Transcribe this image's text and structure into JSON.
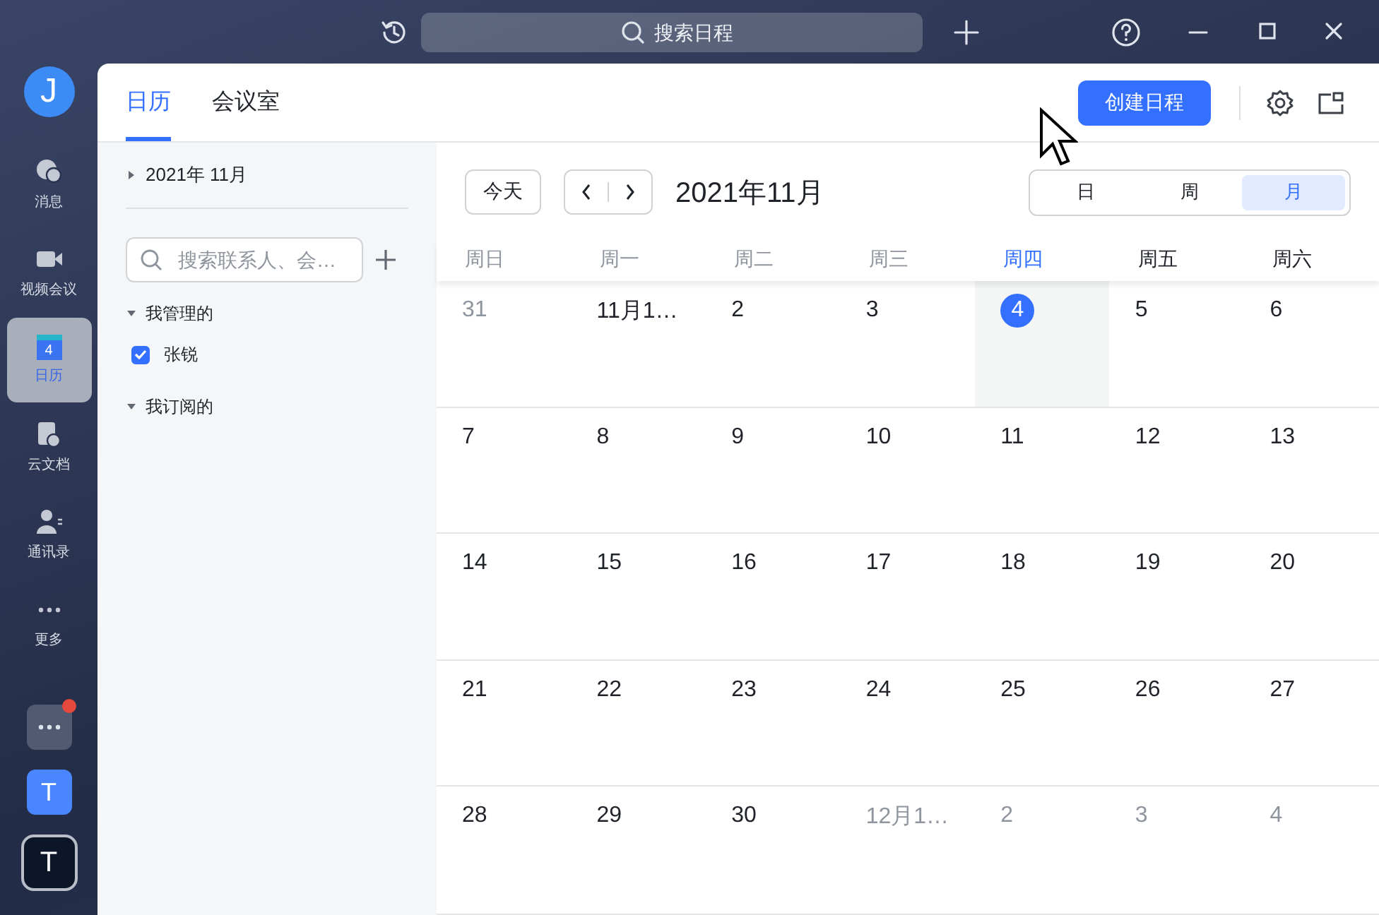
{
  "title_bar": {
    "search": {
      "placeholder": "搜索日程"
    }
  },
  "rail": {
    "avatar": "J",
    "items": [
      {
        "kind": "chat",
        "label": "消息",
        "selected": false
      },
      {
        "kind": "video",
        "label": "视频会议",
        "selected": false
      },
      {
        "kind": "calendar",
        "label": "日历",
        "icon_text": "4",
        "selected": true
      },
      {
        "kind": "docs",
        "label": "云文档",
        "selected": false
      },
      {
        "kind": "contacts",
        "label": "通讯录",
        "selected": false
      },
      {
        "kind": "more",
        "label": "更多",
        "selected": false
      }
    ],
    "apps": [
      {
        "kind": "more",
        "unread": true
      },
      {
        "kind": "app",
        "label": "T",
        "color": "#4a86ff",
        "selected": false
      },
      {
        "kind": "app",
        "label": "T",
        "color": "#0c1628",
        "selected": true
      }
    ]
  },
  "tabs": [
    {
      "label": "日历",
      "selected": true
    },
    {
      "label": "会议室",
      "selected": false
    }
  ],
  "create_button": "创建日程",
  "sidebar": {
    "month_picker": {
      "label": "2021年 11月",
      "expanded": false
    },
    "search": {
      "placeholder": "搜索联系人、会…"
    },
    "groups": [
      {
        "label": "我管理的",
        "expanded": true,
        "children": [
          {
            "label": "张锐",
            "checked": true
          }
        ]
      },
      {
        "label": "我订阅的",
        "expanded": true
      }
    ]
  },
  "calendar": {
    "today_button": "今天",
    "title": "2021年11月",
    "views": [
      {
        "label": "日",
        "selected": false
      },
      {
        "label": "周",
        "selected": false
      },
      {
        "label": "月",
        "selected": true
      }
    ],
    "weekdays": [
      {
        "label": "周日",
        "kind": "past"
      },
      {
        "label": "周一",
        "kind": "past"
      },
      {
        "label": "周二",
        "kind": "past"
      },
      {
        "label": "周三",
        "kind": "past"
      },
      {
        "label": "周四",
        "kind": "today"
      },
      {
        "label": "周五",
        "kind": "upcoming"
      },
      {
        "label": "周六",
        "kind": "upcoming"
      }
    ],
    "weeks": [
      [
        {
          "label": "31",
          "other_month": true,
          "today": false
        },
        {
          "label": "11月1…",
          "other_month": false,
          "today": false
        },
        {
          "label": "2",
          "other_month": false,
          "today": false
        },
        {
          "label": "3",
          "other_month": false,
          "today": false
        },
        {
          "label": "4",
          "other_month": false,
          "today": true
        },
        {
          "label": "5",
          "other_month": false,
          "today": false
        },
        {
          "label": "6",
          "other_month": false,
          "today": false
        }
      ],
      [
        {
          "label": "7",
          "other_month": false,
          "today": false
        },
        {
          "label": "8",
          "other_month": false,
          "today": false
        },
        {
          "label": "9",
          "other_month": false,
          "today": false
        },
        {
          "label": "10",
          "other_month": false,
          "today": false
        },
        {
          "label": "11",
          "other_month": false,
          "today": false
        },
        {
          "label": "12",
          "other_month": false,
          "today": false
        },
        {
          "label": "13",
          "other_month": false,
          "today": false
        }
      ],
      [
        {
          "label": "14",
          "other_month": false,
          "today": false
        },
        {
          "label": "15",
          "other_month": false,
          "today": false
        },
        {
          "label": "16",
          "other_month": false,
          "today": false
        },
        {
          "label": "17",
          "other_month": false,
          "today": false
        },
        {
          "label": "18",
          "other_month": false,
          "today": false
        },
        {
          "label": "19",
          "other_month": false,
          "today": false
        },
        {
          "label": "20",
          "other_month": false,
          "today": false
        }
      ],
      [
        {
          "label": "21",
          "other_month": false,
          "today": false
        },
        {
          "label": "22",
          "other_month": false,
          "today": false
        },
        {
          "label": "23",
          "other_month": false,
          "today": false
        },
        {
          "label": "24",
          "other_month": false,
          "today": false
        },
        {
          "label": "25",
          "other_month": false,
          "today": false
        },
        {
          "label": "26",
          "other_month": false,
          "today": false
        },
        {
          "label": "27",
          "other_month": false,
          "today": false
        }
      ],
      [
        {
          "label": "28",
          "other_month": false,
          "today": false
        },
        {
          "label": "29",
          "other_month": false,
          "today": false
        },
        {
          "label": "30",
          "other_month": false,
          "today": false
        },
        {
          "label": "12月1…",
          "other_month": true,
          "today": false
        },
        {
          "label": "2",
          "other_month": true,
          "today": false
        },
        {
          "label": "3",
          "other_month": true,
          "today": false
        },
        {
          "label": "4",
          "other_month": true,
          "today": false
        }
      ]
    ]
  }
}
